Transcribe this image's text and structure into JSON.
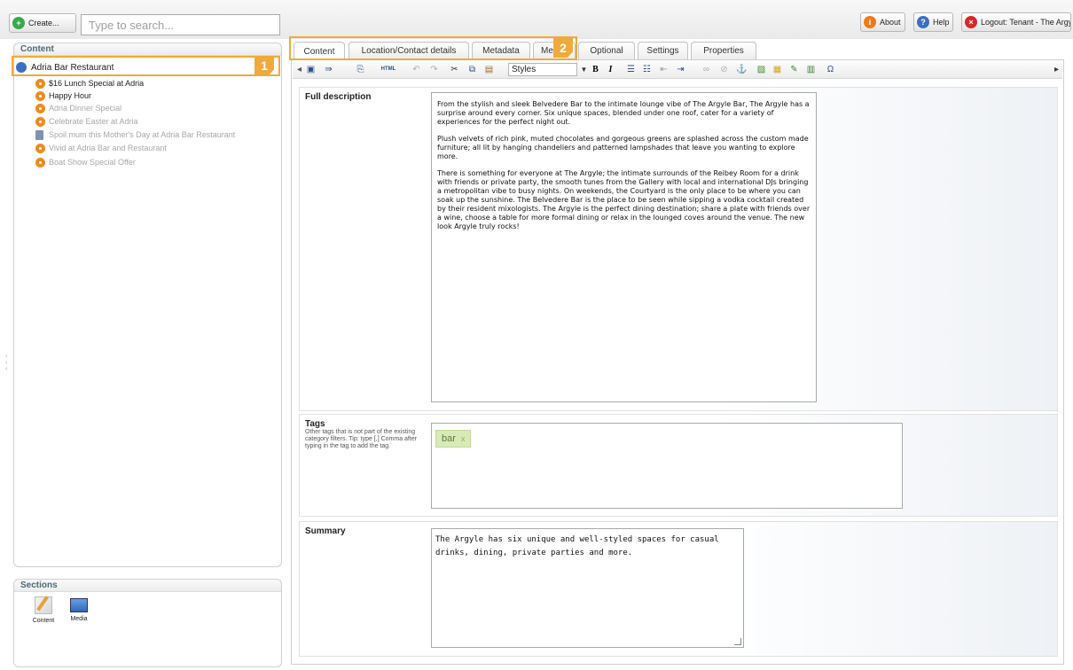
{
  "top_bar": {
    "create_label": "Create...",
    "search_placeholder": "Type to search...",
    "about_label": "About",
    "help_label": "Help",
    "logout_label": "Logout: Tenant - The Argyle"
  },
  "content_tree": {
    "title": "Content",
    "root": "Adria Bar Restaurant",
    "items": [
      {
        "label": "$16 Lunch Special at Adria",
        "published": true
      },
      {
        "label": "Happy Hour",
        "published": true
      },
      {
        "label": "Adria Dinner Special",
        "published": false
      },
      {
        "label": "Celebrate Easter at Adria",
        "published": false
      },
      {
        "label": "Spoil mum this Mother's Day at Adria Bar Restaurant",
        "published": false
      },
      {
        "label": "Vivid at Adria Bar and Restaurant",
        "published": false
      },
      {
        "label": "Boat Show Special Offer",
        "published": false
      }
    ]
  },
  "sections_panel": {
    "title": "Sections",
    "items": [
      {
        "label": "Content",
        "icon": "content-edit-icon"
      },
      {
        "label": "Media",
        "icon": "media-icon"
      }
    ]
  },
  "callouts": {
    "one": "1",
    "two": "2"
  },
  "tabs": [
    "Content",
    "Location/Contact details",
    "Metadata",
    "Me",
    "Optional",
    "Settings",
    "Properties"
  ],
  "active_tab": "Content",
  "toolbar": {
    "styles_label": "Styles",
    "html_label": "HTML",
    "bold_label": "B",
    "italic_label": "I"
  },
  "full_description": {
    "label": "Full description",
    "paragraphs": [
      "From the stylish and sleek Belvedere Bar to the intimate lounge vibe of The Argyle Bar, The Argyle has a surprise around every corner. Six unique spaces, blended under one roof, cater for a variety of experiences for the perfect night out.",
      "Plush velvets of rich pink, muted chocolates and gorgeous greens are splashed across the custom made furniture; all lit by hanging chandeliers and patterned lampshades that leave you wanting to explore more.",
      "There is something for everyone at The Argyle; the intimate surrounds of the Reibey Room for a drink with friends or private party, the smooth tunes from the Gallery with local and international DJs bringing a metropolitan vibe to busy nights. On weekends, the Courtyard is the only place to be where you can soak up the sunshine. The Belvedere Bar is the place to be seen while sipping a vodka cocktail created by their resident mixologists. The Argyle is the perfect dining destination; share a plate with friends over a wine, choose a table for more formal dining or relax in the lounged coves around the venue. The new look Argyle truly rocks!"
    ]
  },
  "tags": {
    "label": "Tags",
    "hint": "Other tags that is not part of the existing category filters. Tip: type [,] Comma after typing in the tag to add the tag.",
    "items": [
      {
        "text": "bar",
        "remove": "x"
      }
    ]
  },
  "summary": {
    "label": "Summary",
    "text": "The Argyle has six unique and well-styled spaces for casual drinks, dining, private parties and more."
  },
  "colors": {
    "accent_highlight": "#f2a93b",
    "published_node": "#ef8a1c",
    "tag_bg": "#d8ebb4"
  }
}
